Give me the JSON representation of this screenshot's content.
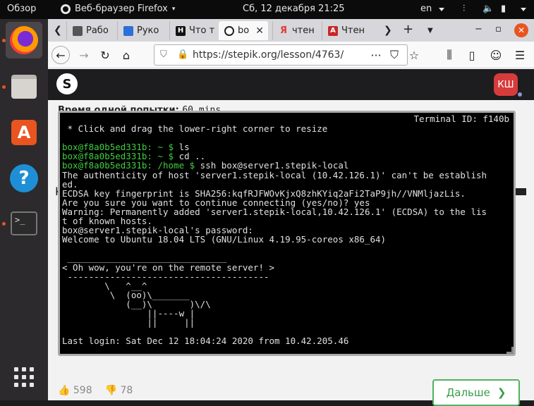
{
  "topbar": {
    "overview": "Обзор",
    "app_name": "Веб-браузер Firefox",
    "clock": "Сб, 12 декабря  21:25",
    "lang": "en",
    "icons": [
      "network-icon",
      "volume-icon",
      "battery-icon"
    ]
  },
  "dock": {
    "items": [
      "firefox-icon",
      "files-icon",
      "software-store-icon",
      "help-icon",
      "terminal-icon"
    ],
    "terminal_glyph": ">_",
    "store_glyph": "A",
    "help_glyph": "?"
  },
  "browser": {
    "tabs": [
      {
        "label": "Рабо",
        "icon_color": "#555555"
      },
      {
        "label": "Руко",
        "icon_color": "#2e6fd9"
      },
      {
        "label": "Что т",
        "icon_color": "#111111"
      },
      {
        "label": "bo",
        "icon_color": "#222222",
        "active": true
      },
      {
        "label": "чтен",
        "icon_color": "#e53935"
      },
      {
        "label": "Чтен",
        "icon_color": "#c62828"
      }
    ],
    "url": "https://stepik.org/lesson/4763/",
    "window_buttons": {
      "minimize": "−",
      "maximize": "▫",
      "close": "✕"
    }
  },
  "page": {
    "avatar_initials": "КШ",
    "time_limit_label": "Время одной попытки:",
    "time_limit_value": "60 mins",
    "partial_letter": "К",
    "likes": "598",
    "dislikes": "78",
    "next_button": "Дальше"
  },
  "terminal": {
    "id_label": "Terminal ID: f140b",
    "lines": [
      {
        "text": " * Click and drag the lower-right corner to resize",
        "color": "white"
      },
      {
        "text": "",
        "color": "white"
      },
      {
        "prompt": "box@f8a0b5ed331b:",
        "path": " ~ $",
        "cmd": " ls"
      },
      {
        "prompt": "box@f8a0b5ed331b:",
        "path": " ~ $",
        "cmd": " cd .."
      },
      {
        "prompt": "box@f8a0b5ed331b:",
        "path": " /home $",
        "cmd": " ssh box@server1.stepik-local"
      },
      {
        "text": "The authenticity of host 'server1.stepik-local (10.42.126.1)' can't be establish",
        "color": "white"
      },
      {
        "text": "ed.",
        "color": "white"
      },
      {
        "text": "ECDSA key fingerprint is SHA256:kqfRJFWOvKjxQ8zhKYiq2aFi2TaP9jh//VNMljazLis.",
        "color": "white"
      },
      {
        "text": "Are you sure you want to continue connecting (yes/no)? yes",
        "color": "white"
      },
      {
        "text": "Warning: Permanently added 'server1.stepik-local,10.42.126.1' (ECDSA) to the lis",
        "color": "white"
      },
      {
        "text": "t of known hosts.",
        "color": "white"
      },
      {
        "text": "box@server1.stepik-local's password:",
        "color": "white"
      },
      {
        "text": "Welcome to Ubuntu 18.04 LTS (GNU/Linux 4.19.95-coreos x86_64)",
        "color": "white"
      },
      {
        "text": "",
        "color": "white"
      },
      {
        "text": " ______________________________",
        "color": "white"
      },
      {
        "text": "< Oh wow, you're on the remote server! >",
        "color": "white"
      },
      {
        "text": " --------------------------------------",
        "color": "white"
      },
      {
        "text": "        \\   ^__^",
        "color": "white"
      },
      {
        "text": "         \\  (oo)\\_______",
        "color": "white"
      },
      {
        "text": "            (__)\\       )\\/\\",
        "color": "white"
      },
      {
        "text": "                ||----w |",
        "color": "white"
      },
      {
        "text": "                ||     ||",
        "color": "white"
      },
      {
        "text": "",
        "color": "white"
      },
      {
        "text": "Last login: Sat Dec 12 18:04:24 2020 from 10.42.205.46",
        "color": "white"
      }
    ]
  }
}
